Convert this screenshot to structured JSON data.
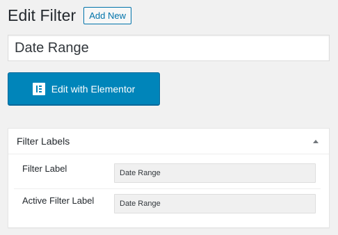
{
  "header": {
    "title": "Edit Filter",
    "add_new_label": "Add New"
  },
  "post_title": {
    "value": "Date Range"
  },
  "elementor_button": {
    "label": "Edit with Elementor",
    "icon": "elementor-icon",
    "bg_color": "#0085ba"
  },
  "filter_labels_box": {
    "title": "Filter Labels",
    "toggle_icon": "triangle-up-icon",
    "fields": [
      {
        "label": "Filter Label",
        "value": "Date Range"
      },
      {
        "label": "Active Filter Label",
        "value": "Date Range"
      }
    ]
  },
  "colors": {
    "accent": "#0073aa",
    "page_bg": "#f1f1f1"
  }
}
